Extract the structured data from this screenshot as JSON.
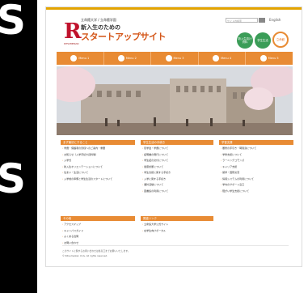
{
  "side": {
    "top_letter": "S",
    "bottom_letter": "S"
  },
  "header": {
    "logo_letter": "R",
    "logo_univ": "RITSUMEIKAN",
    "univ_name": "立命館大学 / 立命館学園",
    "title_line1": "新入生のための",
    "title_line2": "スタートアップサイト",
    "search_placeholder": "サイト内検索",
    "language": "English",
    "circles": [
      {
        "label": "新入生向け資料"
      },
      {
        "label": "学生生活"
      },
      {
        "label": "立命館"
      }
    ]
  },
  "nav": [
    {
      "label": "Menu 1"
    },
    {
      "label": "Menu 2"
    },
    {
      "label": "Menu 3"
    },
    {
      "label": "Menu 4"
    },
    {
      "label": "Menu 5"
    }
  ],
  "sections": {
    "col1": {
      "heading": "まず最初にすること",
      "items": [
        "学費・保護者の皆様へのご案内・重要",
        "お知らせ（入学手続き資料等）",
        "入学式",
        "新入生オリエンテーションについて",
        "住まい・生活について",
        "入学前の準備と学生生活のスタートについて"
      ]
    },
    "col2": {
      "heading": "学生生活の手続き",
      "items": [
        "奨学金・学費について",
        "証明書の発行について",
        "学生証の交付について",
        "健康診断について",
        "学生支援に関する手続き",
        "入学に関する手続き",
        "課外活動について",
        "図書館の利用について"
      ]
    },
    "col3": {
      "heading": "学習支援",
      "items": [
        "履修の手引き・時間割について",
        "学修支援について",
        "ラーニングコモンズ",
        "キャリア支援",
        "留学・国際交流",
        "情報システムの利用について",
        "学内のサポート窓口",
        "障がい学生支援について"
      ]
    },
    "col4": {
      "heading": "その他",
      "items": [
        "アクセスマップ",
        "キャンパスガイド",
        "よくある質問",
        "お問い合わせ"
      ]
    },
    "col5": {
      "heading": "関連リンク",
      "items": [
        "立命館大学公式サイト",
        "在学生向けポータル"
      ]
    }
  },
  "footer": {
    "line1": "このサイトに関するお問い合わせは各窓口までお願いいたします。",
    "line2": "© Ritsumeikan Univ. All rights reserved."
  },
  "colors": {
    "accent": "#e88b34",
    "green": "#3b9d58",
    "brand": "#c0122c"
  }
}
